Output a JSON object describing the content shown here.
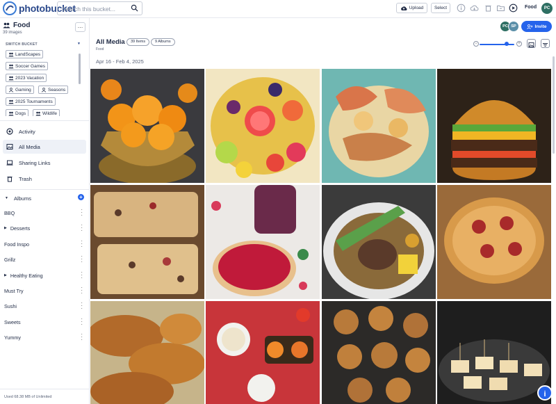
{
  "app": {
    "brand": "photobucket",
    "brand_color": "#2c4a8c",
    "accent": "#2563eb"
  },
  "topbar": {
    "search_placeholder": "Search this bucket...",
    "upload_label": "Upload",
    "select_label": "Select",
    "bucket_name": "Food",
    "user_initials": "PC",
    "icons": [
      "info-icon",
      "cloud-download-icon",
      "trash-icon",
      "folder-icon",
      "play-icon"
    ]
  },
  "sidebar": {
    "title": "Food",
    "count": "39 images",
    "switch_label": "SWITCH BUCKET",
    "buckets": [
      "LandScapes",
      "Soccer Games",
      "2023 Vacation",
      "Gaming",
      "Seasons",
      "2025 Tournaments",
      "Dogs",
      "Wildlife"
    ],
    "nav": [
      {
        "label": "Activity",
        "icon": "activity-icon"
      },
      {
        "label": "All Media",
        "icon": "gallery-icon"
      },
      {
        "label": "Sharing Links",
        "icon": "laptop-link-icon"
      },
      {
        "label": "Trash",
        "icon": "trash-icon"
      }
    ],
    "albums_label": "Albums",
    "albums": [
      {
        "label": "BBQ",
        "expandable": false
      },
      {
        "label": "Desserts",
        "expandable": true
      },
      {
        "label": "Food Inspo",
        "expandable": false
      },
      {
        "label": "Grillz",
        "expandable": false
      },
      {
        "label": "Healthy Eating",
        "expandable": true
      },
      {
        "label": "Must Try",
        "expandable": false
      },
      {
        "label": "Sushi",
        "expandable": false
      },
      {
        "label": "Sweets",
        "expandable": false
      },
      {
        "label": "Yummy",
        "expandable": false
      }
    ],
    "storage": "Used 68.38 MB of Unlimited"
  },
  "main": {
    "collaborators": [
      {
        "initials": "PC",
        "color": "#2e6f63"
      },
      {
        "initials": "SP",
        "color": "#5b8fa8"
      }
    ],
    "invite_label": "Invite",
    "title": "All Media",
    "items_pill": "39 Items",
    "albums_pill": "9 Albums",
    "breadcrumb": "Food",
    "date_range": "Apr 16 - Feb 4, 2025",
    "zoom_level": 0.78,
    "photos": [
      {
        "name": "mandarins-photo"
      },
      {
        "name": "fruit-platter-photo"
      },
      {
        "name": "seafood-platter-photo"
      },
      {
        "name": "burger-photo"
      },
      {
        "name": "focaccia-photo"
      },
      {
        "name": "berry-tart-photo"
      },
      {
        "name": "stew-bowl-photo"
      },
      {
        "name": "pepperoni-pizza-photo"
      },
      {
        "name": "bagels-photo"
      },
      {
        "name": "picnic-table-photo"
      },
      {
        "name": "cinnamon-knots-photo"
      },
      {
        "name": "canapes-photo"
      }
    ]
  }
}
